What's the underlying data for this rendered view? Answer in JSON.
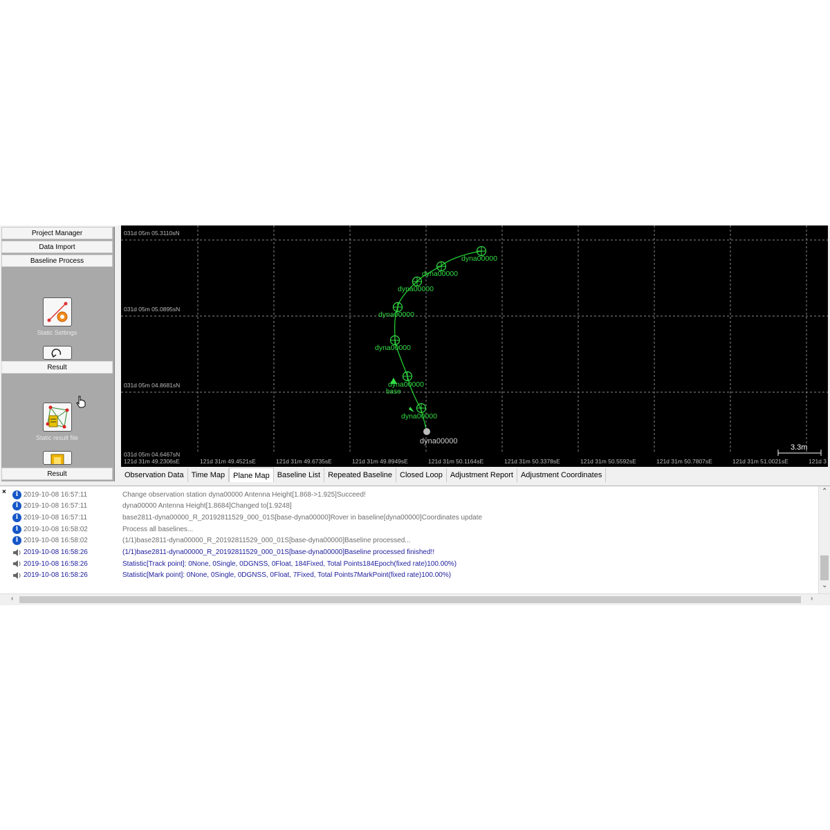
{
  "nav": {
    "buttons": [
      "Project Manager",
      "Data Import",
      "Baseline Process"
    ],
    "section_result_label": "Result",
    "tool_static_settings": "Static Settings",
    "tool_static_result_file": "Static result file",
    "bottom_result_label": "Result"
  },
  "map": {
    "lat_labels": [
      "031d 05m 05.3110sN",
      "031d 05m 05.0895sN",
      "031d 05m 04.8681sN",
      "031d 05m 04.6467sN"
    ],
    "lon_labels": [
      "121d 31m 49.2306sE",
      "121d 31m 49.4521sE",
      "121d 31m 49.6735sE",
      "121d 31m 49.8949sE",
      "121d 31m 50.1164sE",
      "121d 31m 50.3378sE",
      "121d 31m 50.5592sE",
      "121d 31m 50.7807sE",
      "121d 31m 51.0021sE",
      "121d 3"
    ],
    "points": [
      {
        "label": "dyna00000"
      },
      {
        "label": "dyna00000"
      },
      {
        "label": "dyna00000"
      },
      {
        "label": "dyna00000"
      },
      {
        "label": "dyna00000"
      },
      {
        "label": "dyna00000"
      },
      {
        "label": "dyna00000"
      }
    ],
    "base_label": "base",
    "gray_point_label": "dyna00000",
    "scale_label": "3.3m",
    "colors": {
      "background": "#000000",
      "track": "#22cc33",
      "labels": "#33dd44",
      "grid": "#8a8a8a"
    }
  },
  "tabs": [
    "Observation Data",
    "Time Map",
    "Plane Map",
    "Baseline List",
    "Repeated Baseline",
    "Closed Loop",
    "Adjustment Report",
    "Adjustment Coordinates"
  ],
  "active_tab": "Plane Map",
  "log": [
    {
      "icon": "info-icon",
      "time": "2019-10-08 16:57:11",
      "msg": "Change observation station dyna00000 Antenna Height[1.868->1.925]Succeed!",
      "color": "gray"
    },
    {
      "icon": "info-icon",
      "time": "2019-10-08 16:57:11",
      "msg": "dyna00000 Antenna Height[1.8684]Changed to[1.9248]",
      "color": "gray"
    },
    {
      "icon": "info-icon",
      "time": "2019-10-08 16:57:11",
      "msg": "base2811-dyna00000_R_20192811529_000_01S[base-dyna00000]Rover in baseline[dyna00000]Coordinates update",
      "color": "gray"
    },
    {
      "icon": "info-icon",
      "time": "2019-10-08 16:58:02",
      "msg": "Process all baselines...",
      "color": "gray"
    },
    {
      "icon": "info-icon",
      "time": "2019-10-08 16:58:02",
      "msg": "(1/1)base2811-dyna00000_R_20192811529_000_01S[base-dyna00000]Baseline processed...",
      "color": "gray"
    },
    {
      "icon": "speaker-icon",
      "time": "2019-10-08 16:58:26",
      "msg": "(1/1)base2811-dyna00000_R_20192811529_000_01S[base-dyna00000]Baseline processed finished!!",
      "color": "blue"
    },
    {
      "icon": "speaker-icon",
      "time": "2019-10-08 16:58:26",
      "msg": "Statistic[Track point]: 0None, 0Single, 0DGNSS, 0Float, 184Fixed, Total Points184Epoch(fixed rate)100.00%)",
      "color": "blue"
    },
    {
      "icon": "speaker-icon",
      "time": "2019-10-08 16:58:26",
      "msg": "Statistic[Mark point]: 0None, 0Single, 0DGNSS, 0Float, 7Fixed, Total Points7MarkPoint(fixed rate)100.00%)",
      "color": "blue"
    }
  ],
  "log_close_glyph": "×"
}
